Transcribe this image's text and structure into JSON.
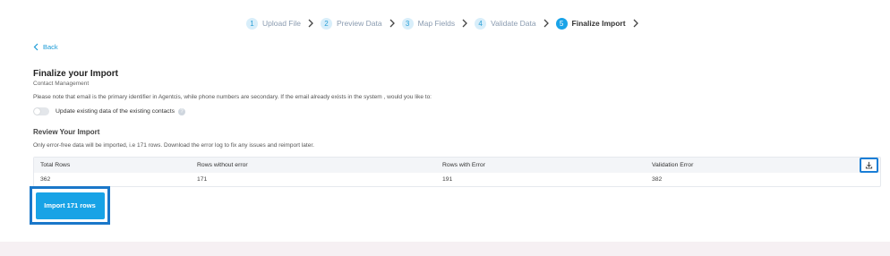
{
  "stepper": {
    "steps": [
      {
        "num": "1",
        "label": "Upload File"
      },
      {
        "num": "2",
        "label": "Preview Data"
      },
      {
        "num": "3",
        "label": "Map Fields"
      },
      {
        "num": "4",
        "label": "Validate Data"
      },
      {
        "num": "5",
        "label": "Finalize Import"
      }
    ],
    "active_index": 4
  },
  "back_label": "Back",
  "page": {
    "title": "Finalize your Import",
    "subtitle": "Contact Management",
    "note": "Please note that email is the primary identifier in Agentcis, while phone numbers are secondary. If the email already exists in the system , would you like to:",
    "toggle_label": "Update existing data of the existing contacts",
    "toggle_on": false
  },
  "review": {
    "title": "Review Your Import",
    "note": "Only error-free data will be imported, i.e 171 rows. Download the error log to fix any issues and reimport later.",
    "headers": [
      "Total Rows",
      "Rows without error",
      "Rows with Error",
      "Validation Error"
    ],
    "values": [
      "362",
      "171",
      "191",
      "382"
    ]
  },
  "import_button_label": "Import 171 rows",
  "colors": {
    "accent": "#18a3e6",
    "focus_outline": "#1a77c9"
  }
}
